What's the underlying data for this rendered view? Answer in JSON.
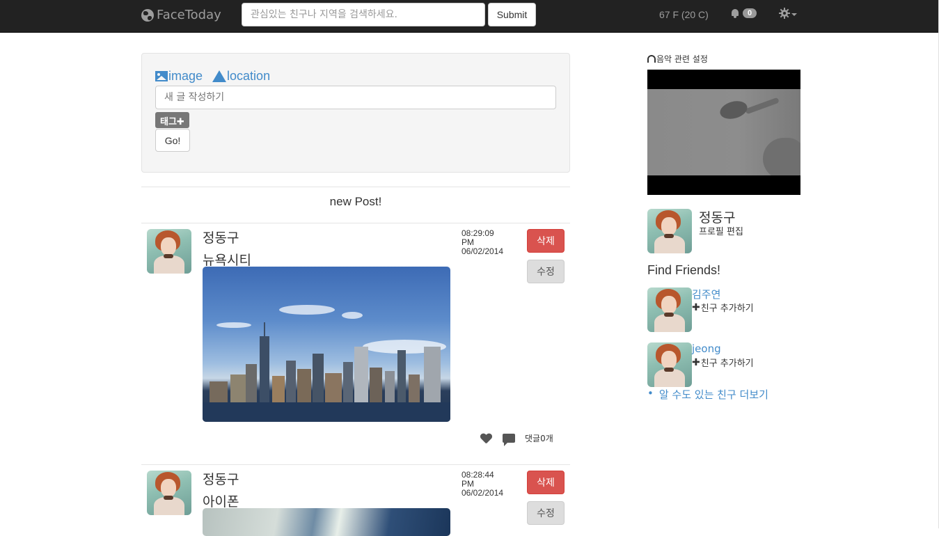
{
  "navbar": {
    "brand": "FaceToday",
    "search_placeholder": "관심있는 친구나 지역을 검색하세요.",
    "submit_label": "Submit",
    "weather": "67 F (20 C)",
    "notification_count": "0"
  },
  "compose": {
    "image_label": "image",
    "location_label": "location",
    "input_placeholder": "새 글 작성하기",
    "tag_label": "태그✚",
    "go_label": "Go!"
  },
  "feed": {
    "header": "new Post!",
    "posts": [
      {
        "author": "정동구",
        "text": "뉴욕시티",
        "time": "08:29:09",
        "ampm": "PM",
        "date": "06/02/2014",
        "delete_label": "삭제",
        "edit_label": "수정",
        "comment_count": "댓글0개"
      },
      {
        "author": "정동구",
        "text": "아이폰",
        "time": "08:28:44",
        "ampm": "PM",
        "date": "06/02/2014",
        "delete_label": "삭제",
        "edit_label": "수정"
      }
    ]
  },
  "sidebar": {
    "music_title": "음악 관련 설정",
    "profile_name": "정동구",
    "profile_edit": "프로필 편집",
    "find_friends_title": "Find Friends!",
    "friends": [
      {
        "name": "김주연",
        "add_label": "친구 추가하기"
      },
      {
        "name": "jeong",
        "add_label": "친구 추가하기"
      }
    ],
    "more_friends": "알 수도 있는 친구 더보기"
  },
  "colors": {
    "navbar_bg": "#222222",
    "link": "#428bca",
    "danger": "#d9534f"
  }
}
